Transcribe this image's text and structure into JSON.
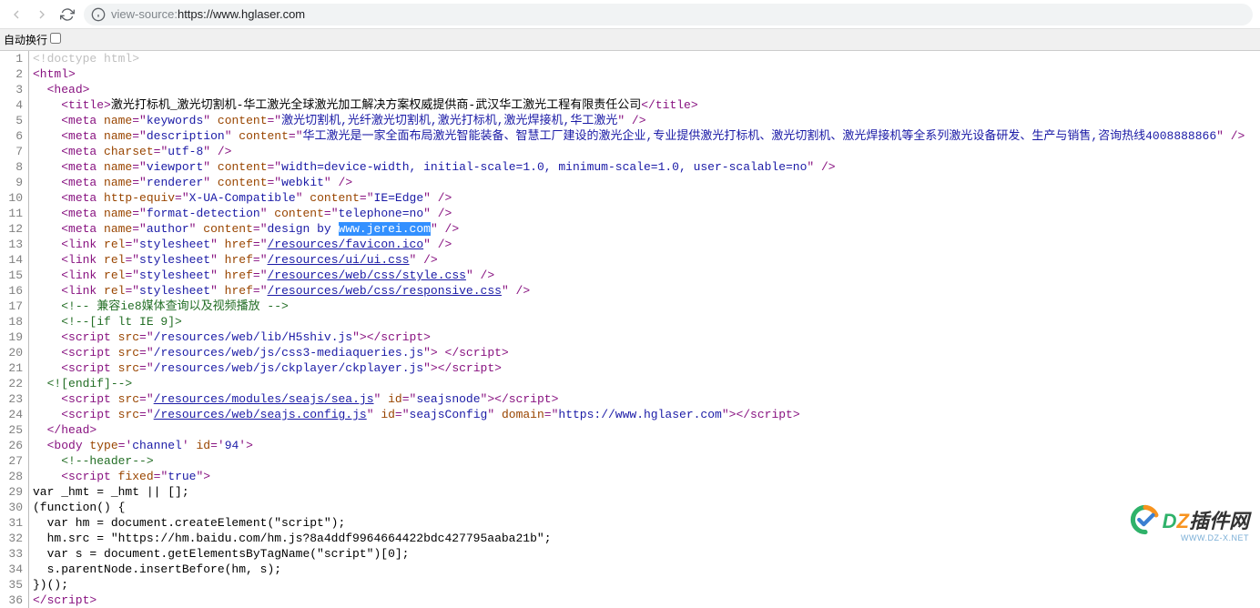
{
  "toolbar": {
    "url_prefix": "view-source:",
    "url": "https://www.hglaser.com"
  },
  "wrap": {
    "label": "自动换行"
  },
  "lines": [
    {
      "n": 1,
      "seg": [
        {
          "c": "doctype",
          "t": "<!doctype html>"
        }
      ]
    },
    {
      "n": 2,
      "seg": [
        {
          "c": "tag",
          "t": "<html>"
        }
      ]
    },
    {
      "n": 3,
      "indent": 1,
      "seg": [
        {
          "c": "tag",
          "t": "<head>"
        }
      ]
    },
    {
      "n": 4,
      "indent": 2,
      "seg": [
        {
          "c": "tag",
          "t": "<title>"
        },
        {
          "c": "",
          "t": "激光打标机_激光切割机-华工激光全球激光加工解决方案权威提供商-武汉华工激光工程有限责任公司"
        },
        {
          "c": "tag",
          "t": "</title>"
        }
      ]
    },
    {
      "n": 5,
      "indent": 2,
      "seg": [
        {
          "c": "tag",
          "t": "<meta "
        },
        {
          "c": "attr-name",
          "t": "name"
        },
        {
          "c": "tag",
          "t": "=\""
        },
        {
          "c": "attr-value",
          "t": "keywords"
        },
        {
          "c": "tag",
          "t": "\" "
        },
        {
          "c": "attr-name",
          "t": "content"
        },
        {
          "c": "tag",
          "t": "=\""
        },
        {
          "c": "attr-value",
          "t": "激光切割机,光纤激光切割机,激光打标机,激光焊接机,华工激光"
        },
        {
          "c": "tag",
          "t": "\" />"
        }
      ]
    },
    {
      "n": 6,
      "indent": 2,
      "seg": [
        {
          "c": "tag",
          "t": "<meta "
        },
        {
          "c": "attr-name",
          "t": "name"
        },
        {
          "c": "tag",
          "t": "=\""
        },
        {
          "c": "attr-value",
          "t": "description"
        },
        {
          "c": "tag",
          "t": "\" "
        },
        {
          "c": "attr-name",
          "t": "content"
        },
        {
          "c": "tag",
          "t": "=\""
        },
        {
          "c": "attr-value",
          "t": "华工激光是一家全面布局激光智能装备、智慧工厂建设的激光企业,专业提供激光打标机、激光切割机、激光焊接机等全系列激光设备研发、生产与销售,咨询热线4008888866"
        },
        {
          "c": "tag",
          "t": "\" />"
        }
      ]
    },
    {
      "n": 7,
      "indent": 2,
      "seg": [
        {
          "c": "tag",
          "t": "<meta "
        },
        {
          "c": "attr-name",
          "t": "charset"
        },
        {
          "c": "tag",
          "t": "=\""
        },
        {
          "c": "attr-value",
          "t": "utf-8"
        },
        {
          "c": "tag",
          "t": "\" />"
        }
      ]
    },
    {
      "n": 8,
      "indent": 2,
      "seg": [
        {
          "c": "tag",
          "t": "<meta "
        },
        {
          "c": "attr-name",
          "t": "name"
        },
        {
          "c": "tag",
          "t": "=\""
        },
        {
          "c": "attr-value",
          "t": "viewport"
        },
        {
          "c": "tag",
          "t": "\" "
        },
        {
          "c": "attr-name",
          "t": "content"
        },
        {
          "c": "tag",
          "t": "=\""
        },
        {
          "c": "attr-value",
          "t": "width=device-width, initial-scale=1.0, minimum-scale=1.0, user-scalable=no"
        },
        {
          "c": "tag",
          "t": "\" />"
        }
      ]
    },
    {
      "n": 9,
      "indent": 2,
      "seg": [
        {
          "c": "tag",
          "t": "<meta "
        },
        {
          "c": "attr-name",
          "t": "name"
        },
        {
          "c": "tag",
          "t": "=\""
        },
        {
          "c": "attr-value",
          "t": "renderer"
        },
        {
          "c": "tag",
          "t": "\" "
        },
        {
          "c": "attr-name",
          "t": "content"
        },
        {
          "c": "tag",
          "t": "=\""
        },
        {
          "c": "attr-value",
          "t": "webkit"
        },
        {
          "c": "tag",
          "t": "\" />"
        }
      ]
    },
    {
      "n": 10,
      "indent": 2,
      "seg": [
        {
          "c": "tag",
          "t": "<meta "
        },
        {
          "c": "attr-name",
          "t": "http-equiv"
        },
        {
          "c": "tag",
          "t": "=\""
        },
        {
          "c": "attr-value",
          "t": "X-UA-Compatible"
        },
        {
          "c": "tag",
          "t": "\" "
        },
        {
          "c": "attr-name",
          "t": "content"
        },
        {
          "c": "tag",
          "t": "=\""
        },
        {
          "c": "attr-value",
          "t": "IE=Edge"
        },
        {
          "c": "tag",
          "t": "\" />"
        }
      ]
    },
    {
      "n": 11,
      "indent": 2,
      "seg": [
        {
          "c": "tag",
          "t": "<meta "
        },
        {
          "c": "attr-name",
          "t": "name"
        },
        {
          "c": "tag",
          "t": "=\""
        },
        {
          "c": "attr-value",
          "t": "format-detection"
        },
        {
          "c": "tag",
          "t": "\" "
        },
        {
          "c": "attr-name",
          "t": "content"
        },
        {
          "c": "tag",
          "t": "=\""
        },
        {
          "c": "attr-value",
          "t": "telephone=no"
        },
        {
          "c": "tag",
          "t": "\" />"
        }
      ]
    },
    {
      "n": 12,
      "indent": 2,
      "seg": [
        {
          "c": "tag",
          "t": "<meta "
        },
        {
          "c": "attr-name",
          "t": "name"
        },
        {
          "c": "tag",
          "t": "=\""
        },
        {
          "c": "attr-value",
          "t": "author"
        },
        {
          "c": "tag",
          "t": "\" "
        },
        {
          "c": "attr-name",
          "t": "content"
        },
        {
          "c": "tag",
          "t": "=\""
        },
        {
          "c": "attr-value",
          "t": "design by "
        },
        {
          "c": "selected",
          "t": "www.jerei.com"
        },
        {
          "c": "tag",
          "t": "\" />"
        }
      ]
    },
    {
      "n": 13,
      "indent": 2,
      "seg": [
        {
          "c": "tag",
          "t": "<link "
        },
        {
          "c": "attr-name",
          "t": "rel"
        },
        {
          "c": "tag",
          "t": "=\""
        },
        {
          "c": "attr-value",
          "t": "stylesheet"
        },
        {
          "c": "tag",
          "t": "\" "
        },
        {
          "c": "attr-name",
          "t": "href"
        },
        {
          "c": "tag",
          "t": "=\""
        },
        {
          "c": "link",
          "t": "/resources/favicon.ico"
        },
        {
          "c": "tag",
          "t": "\" />"
        }
      ]
    },
    {
      "n": 14,
      "indent": 2,
      "seg": [
        {
          "c": "tag",
          "t": "<link "
        },
        {
          "c": "attr-name",
          "t": "rel"
        },
        {
          "c": "tag",
          "t": "=\""
        },
        {
          "c": "attr-value",
          "t": "stylesheet"
        },
        {
          "c": "tag",
          "t": "\" "
        },
        {
          "c": "attr-name",
          "t": "href"
        },
        {
          "c": "tag",
          "t": "=\""
        },
        {
          "c": "link",
          "t": "/resources/ui/ui.css"
        },
        {
          "c": "tag",
          "t": "\" />"
        }
      ]
    },
    {
      "n": 15,
      "indent": 2,
      "seg": [
        {
          "c": "tag",
          "t": "<link "
        },
        {
          "c": "attr-name",
          "t": "rel"
        },
        {
          "c": "tag",
          "t": "=\""
        },
        {
          "c": "attr-value",
          "t": "stylesheet"
        },
        {
          "c": "tag",
          "t": "\" "
        },
        {
          "c": "attr-name",
          "t": "href"
        },
        {
          "c": "tag",
          "t": "=\""
        },
        {
          "c": "link",
          "t": "/resources/web/css/style.css"
        },
        {
          "c": "tag",
          "t": "\" />"
        }
      ]
    },
    {
      "n": 16,
      "indent": 2,
      "seg": [
        {
          "c": "tag",
          "t": "<link "
        },
        {
          "c": "attr-name",
          "t": "rel"
        },
        {
          "c": "tag",
          "t": "=\""
        },
        {
          "c": "attr-value",
          "t": "stylesheet"
        },
        {
          "c": "tag",
          "t": "\" "
        },
        {
          "c": "attr-name",
          "t": "href"
        },
        {
          "c": "tag",
          "t": "=\""
        },
        {
          "c": "link",
          "t": "/resources/web/css/responsive.css"
        },
        {
          "c": "tag",
          "t": "\" />"
        }
      ]
    },
    {
      "n": 17,
      "indent": 2,
      "seg": [
        {
          "c": "comment",
          "t": "<!-- 兼容ie8媒体查询以及视频播放 -->"
        }
      ]
    },
    {
      "n": 18,
      "indent": 2,
      "seg": [
        {
          "c": "comment",
          "t": "<!--[if lt IE 9]>"
        }
      ]
    },
    {
      "n": 19,
      "indent": 2,
      "seg": [
        {
          "c": "tag",
          "t": "<script "
        },
        {
          "c": "attr-name",
          "t": "src"
        },
        {
          "c": "tag",
          "t": "=\""
        },
        {
          "c": "attr-value",
          "t": "/resources/web/lib/H5shiv.js"
        },
        {
          "c": "tag",
          "t": "\">"
        },
        {
          "c": "tag",
          "t": "</script>"
        }
      ]
    },
    {
      "n": 20,
      "indent": 2,
      "seg": [
        {
          "c": "tag",
          "t": "<script "
        },
        {
          "c": "attr-name",
          "t": "src"
        },
        {
          "c": "tag",
          "t": "=\""
        },
        {
          "c": "attr-value",
          "t": "/resources/web/js/css3-mediaqueries.js"
        },
        {
          "c": "tag",
          "t": "\"> "
        },
        {
          "c": "tag",
          "t": "</script>"
        }
      ]
    },
    {
      "n": 21,
      "indent": 2,
      "seg": [
        {
          "c": "tag",
          "t": "<script "
        },
        {
          "c": "attr-name",
          "t": "src"
        },
        {
          "c": "tag",
          "t": "=\""
        },
        {
          "c": "attr-value",
          "t": "/resources/web/js/ckplayer/ckplayer.js"
        },
        {
          "c": "tag",
          "t": "\">"
        },
        {
          "c": "tag",
          "t": "</script>"
        }
      ]
    },
    {
      "n": 22,
      "indent": 1,
      "seg": [
        {
          "c": "comment",
          "t": "<![endif]-->"
        }
      ]
    },
    {
      "n": 23,
      "indent": 2,
      "seg": [
        {
          "c": "tag",
          "t": "<script "
        },
        {
          "c": "attr-name",
          "t": "src"
        },
        {
          "c": "tag",
          "t": "=\""
        },
        {
          "c": "link",
          "t": "/resources/modules/seajs/sea.js"
        },
        {
          "c": "tag",
          "t": "\" "
        },
        {
          "c": "attr-name",
          "t": "id"
        },
        {
          "c": "tag",
          "t": "=\""
        },
        {
          "c": "attr-value",
          "t": "seajsnode"
        },
        {
          "c": "tag",
          "t": "\">"
        },
        {
          "c": "tag",
          "t": "</script>"
        }
      ]
    },
    {
      "n": 24,
      "indent": 2,
      "seg": [
        {
          "c": "tag",
          "t": "<script "
        },
        {
          "c": "attr-name",
          "t": "src"
        },
        {
          "c": "tag",
          "t": "=\""
        },
        {
          "c": "link",
          "t": "/resources/web/seajs.config.js"
        },
        {
          "c": "tag",
          "t": "\" "
        },
        {
          "c": "attr-name",
          "t": "id"
        },
        {
          "c": "tag",
          "t": "=\""
        },
        {
          "c": "attr-value",
          "t": "seajsConfig"
        },
        {
          "c": "tag",
          "t": "\" "
        },
        {
          "c": "attr-name",
          "t": "domain"
        },
        {
          "c": "tag",
          "t": "=\""
        },
        {
          "c": "attr-value",
          "t": "https://www.hglaser.com"
        },
        {
          "c": "tag",
          "t": "\">"
        },
        {
          "c": "tag",
          "t": "</script>"
        }
      ]
    },
    {
      "n": 25,
      "indent": 1,
      "seg": [
        {
          "c": "tag",
          "t": "</head>"
        }
      ]
    },
    {
      "n": 26,
      "indent": 1,
      "seg": [
        {
          "c": "tag",
          "t": "<body "
        },
        {
          "c": "attr-name",
          "t": "type"
        },
        {
          "c": "tag",
          "t": "='"
        },
        {
          "c": "attr-value",
          "t": "channel"
        },
        {
          "c": "tag",
          "t": "' "
        },
        {
          "c": "attr-name",
          "t": "id"
        },
        {
          "c": "tag",
          "t": "='"
        },
        {
          "c": "attr-value",
          "t": "94"
        },
        {
          "c": "tag",
          "t": "'>"
        }
      ]
    },
    {
      "n": 27,
      "indent": 2,
      "seg": [
        {
          "c": "comment",
          "t": "<!--header-->"
        }
      ]
    },
    {
      "n": 28,
      "indent": 2,
      "seg": [
        {
          "c": "tag",
          "t": "<script "
        },
        {
          "c": "attr-name",
          "t": "fixed"
        },
        {
          "c": "tag",
          "t": "=\""
        },
        {
          "c": "attr-value",
          "t": "true"
        },
        {
          "c": "tag",
          "t": "\">"
        }
      ]
    },
    {
      "n": 29,
      "seg": [
        {
          "c": "js-text",
          "t": "var _hmt = _hmt || [];"
        }
      ]
    },
    {
      "n": 30,
      "seg": [
        {
          "c": "js-text",
          "t": "(function() {"
        }
      ]
    },
    {
      "n": 31,
      "seg": [
        {
          "c": "js-text",
          "t": "  var hm = document.createElement(\"script\");"
        }
      ]
    },
    {
      "n": 32,
      "seg": [
        {
          "c": "js-text",
          "t": "  hm.src = \"https://hm.baidu.com/hm.js?8a4ddf9964664422bdc427795aaba21b\";"
        }
      ]
    },
    {
      "n": 33,
      "seg": [
        {
          "c": "js-text",
          "t": "  var s = document.getElementsByTagName(\"script\")[0];"
        }
      ]
    },
    {
      "n": 34,
      "seg": [
        {
          "c": "js-text",
          "t": "  s.parentNode.insertBefore(hm, s);"
        }
      ]
    },
    {
      "n": 35,
      "seg": [
        {
          "c": "js-text",
          "t": "})();"
        }
      ]
    },
    {
      "n": 36,
      "seg": [
        {
          "c": "tag",
          "t": "</script>"
        }
      ]
    }
  ],
  "watermark": {
    "text_d": "D",
    "text_z": "Z",
    "text_cn": "插件网",
    "sub": "WWW.DZ-X.NET"
  }
}
